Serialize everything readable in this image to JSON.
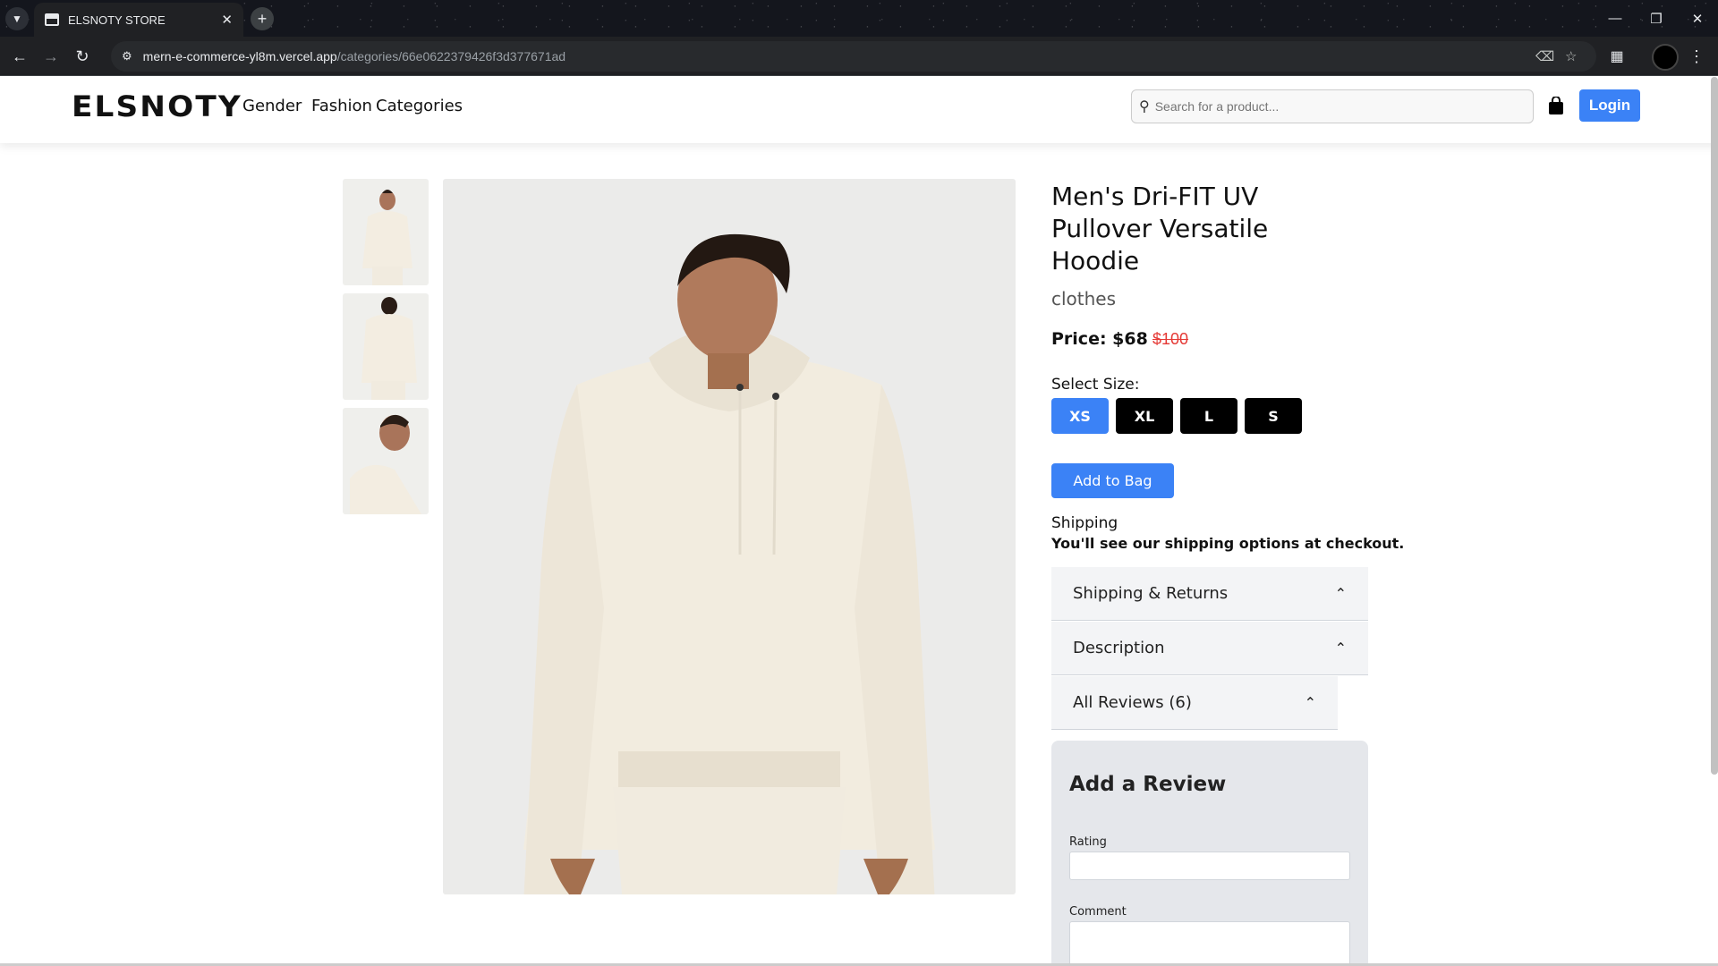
{
  "browser": {
    "tab_title": "ELSNOTY STORE",
    "url_host": "mern-e-commerce-yl8m.vercel.app",
    "url_path": "/categories/66e0622379426f3d377671ad"
  },
  "header": {
    "logo": "ELSNOTY",
    "nav": [
      "Gender",
      "Fashion",
      "Categories"
    ],
    "search_placeholder": "Search for a product...",
    "login_label": "Login"
  },
  "product": {
    "title": "Men's Dri-FIT UV Pullover Versatile Hoodie",
    "category": "clothes",
    "price_label": "Price: $68",
    "old_price": "$100",
    "select_size_label": "Select Size:",
    "sizes": [
      "XS",
      "XL",
      "L",
      "S"
    ],
    "selected_size": "XS",
    "add_to_bag": "Add to Bag",
    "shipping_title": "Shipping",
    "shipping_note": "You'll see our shipping options at checkout."
  },
  "accordions": [
    "Shipping & Returns",
    "Description",
    "All Reviews (6)"
  ],
  "review_form": {
    "title": "Add a Review",
    "rating_label": "Rating",
    "comment_label": "Comment"
  },
  "colors": {
    "accent": "#3b82f6",
    "old_price": "#e53935"
  }
}
